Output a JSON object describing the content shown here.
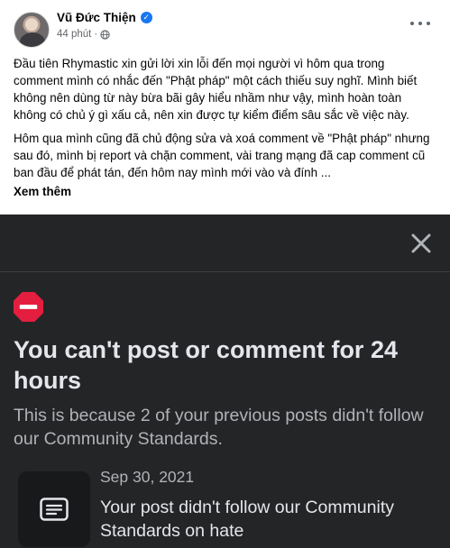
{
  "post": {
    "author": "Vũ Đức Thiện",
    "timestamp": "44 phút",
    "separator": "·",
    "icons": {
      "verified": "verified-badge-icon",
      "privacy": "globe-icon",
      "menu": "more-horizontal-icon"
    },
    "paragraphs": [
      "Đầu tiên Rhymastic xin gửi lời xin lỗi đến mọi người vì hôm qua trong comment mình có nhắc đến \"Phật pháp\" một cách thiếu suy nghĩ. Mình biết không nên dùng từ này bừa bãi gây hiểu nhầm như vậy, mình hoàn toàn không có chủ ý gì xấu cả, nên xin được tự kiểm điểm sâu sắc về việc này.",
      "Hôm qua mình cũng đã chủ động sửa và xoá comment về \"Phật pháp\" nhưng sau đó, mình bị report và chặn comment, vài trang mạng đã cap comment cũ ban đầu để phát tán, đến hôm nay mình mới vào và đính ..."
    ],
    "see_more": "Xem thêm"
  },
  "dialog": {
    "title": "You can't post or comment for 24 hours",
    "subtitle": "This is because 2 of your previous posts didn't follow our Community Standards.",
    "icons": {
      "close": "close-icon",
      "stop": "stop-sign-icon",
      "document": "document-icon"
    },
    "violation": {
      "date": "Sep 30, 2021",
      "text": "Your post didn't follow our Community Standards on hate"
    }
  },
  "colors": {
    "dialog_bg": "#242526",
    "tile_bg": "#18191a",
    "primary_text_dark": "#e4e6eb",
    "secondary_text_dark": "#b0b3b8",
    "stop_red": "#e41e3f",
    "verified_blue": "#1877f2"
  }
}
